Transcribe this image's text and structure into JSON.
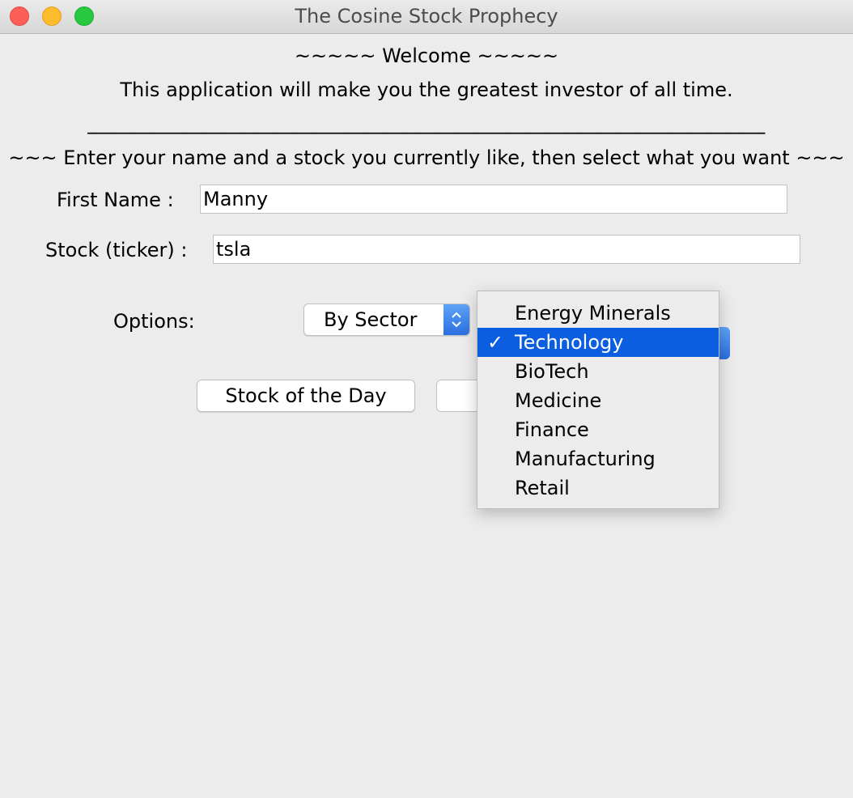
{
  "window": {
    "title": "The Cosine Stock Prophecy"
  },
  "header": {
    "welcome": "~~~~~ Welcome ~~~~~",
    "tagline": "This application will make you the greatest investor of all time.",
    "separator": "___________________________________________________________________",
    "instructions": "~~~ Enter your name and a stock you currently like, then select what you want ~~~"
  },
  "form": {
    "first_name_label": "First Name :",
    "first_name_value": "Manny",
    "stock_label": "Stock (ticker) :",
    "stock_value": "tsla",
    "options_label": "Options:",
    "options_selected": "By Sector"
  },
  "buttons": {
    "stock_of_the_day": "Stock of the Day"
  },
  "sector_dropdown": {
    "check_glyph": "✓",
    "selected_index": 1,
    "items": [
      {
        "label": "Energy Minerals"
      },
      {
        "label": "Technology"
      },
      {
        "label": "BioTech"
      },
      {
        "label": "Medicine"
      },
      {
        "label": "Finance"
      },
      {
        "label": "Manufacturing"
      },
      {
        "label": "Retail"
      }
    ]
  },
  "colors": {
    "selection": "#0b5ee0",
    "accent": "#2a6fe0",
    "window_bg": "#ececec"
  }
}
